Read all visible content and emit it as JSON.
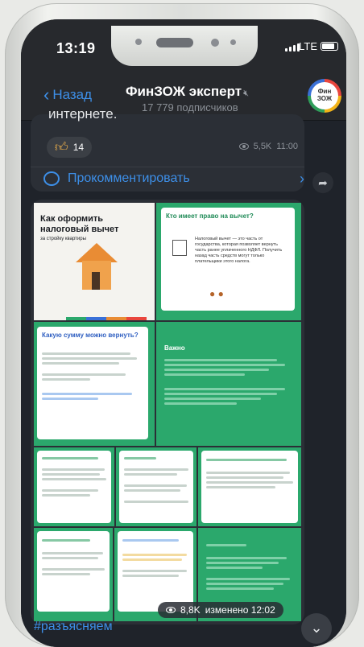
{
  "status": {
    "time": "13:19",
    "network": "LTE"
  },
  "header": {
    "back_label": "Назад",
    "title": "ФинЗОЖ эксперт",
    "mute_icon": "speaker-off-icon",
    "subtitle": "17 779 подписчиков",
    "avatar_text": "Фин ЗОЖ"
  },
  "message1": {
    "cut_text": "интернете.",
    "reaction_count": "14",
    "views": "5,5K",
    "time": "11:00",
    "comment_label": "Прокомментировать"
  },
  "album": {
    "slide1": {
      "title": "Как оформить налоговый вычет",
      "subtitle": "за стройку квартиры"
    },
    "slide2": {
      "heading": "Кто имеет право на вычет?",
      "body": "Налоговый вычет — это часть от государства, которая позволяет вернуть часть ранее уплаченного НДФЛ. Получить назад часть средств могут только плательщики этого налога."
    },
    "slide3": {
      "heading": "Какую сумму можно вернуть?"
    },
    "slide4": {
      "heading": "Важно"
    },
    "views": "8,8K",
    "edited_time": "изменено 12:02"
  },
  "hashtag": "#разъясняем",
  "colors": {
    "accent": "#3d8fe8",
    "green": "#2ba86c",
    "bg": "#1f232a"
  }
}
